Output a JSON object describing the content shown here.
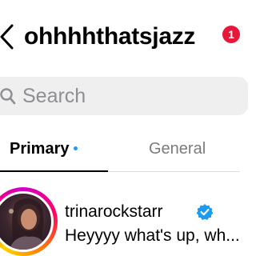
{
  "header": {
    "title": "ohhhhthatsjazz",
    "notification_count": "1"
  },
  "search": {
    "placeholder": "Search"
  },
  "tabs": [
    {
      "label": "Primary",
      "active": true,
      "has_unread_dot": true
    },
    {
      "label": "General",
      "active": false
    }
  ],
  "conversations": [
    {
      "username": "trinarockstarr",
      "verified": true,
      "preview": "Heyyyy what's up, wh..."
    }
  ],
  "colors": {
    "badge": "#e6173a",
    "unread_dot": "#1a9bf0",
    "verified": "#1a9bf0",
    "search_bg": "#efeff0"
  },
  "icons": {
    "back": "chevron-left-icon",
    "search": "search-icon",
    "verified": "verified-badge-icon"
  }
}
